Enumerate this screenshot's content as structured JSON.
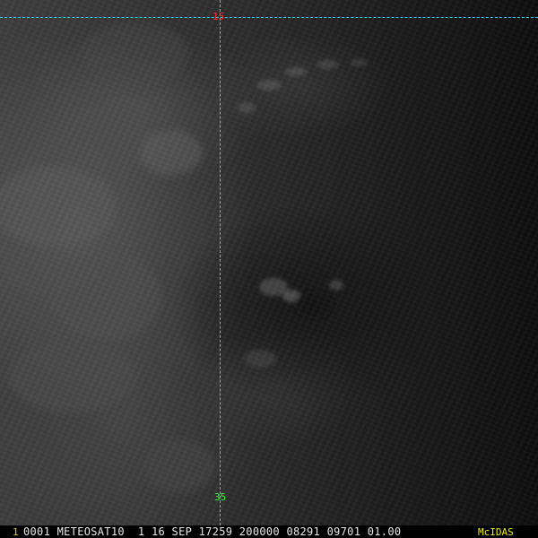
{
  "image": {
    "satellite": "METEOSAT10",
    "colors": {
      "grid_line": "#2fd0e0",
      "lat_label": "#ff3030",
      "lon_label": "#33ff33",
      "frame_number": "#e8d020",
      "status_text": "#e8e8e8",
      "brand": "#f0f000"
    }
  },
  "grid": {
    "latitude_label": "15",
    "longitude_label": "35"
  },
  "status_bar": {
    "frame_number": "1",
    "info_text": "0001 METEOSAT10  1 16 SEP 17259 200000 08291 09701 01.00",
    "brand": "McIDAS"
  }
}
